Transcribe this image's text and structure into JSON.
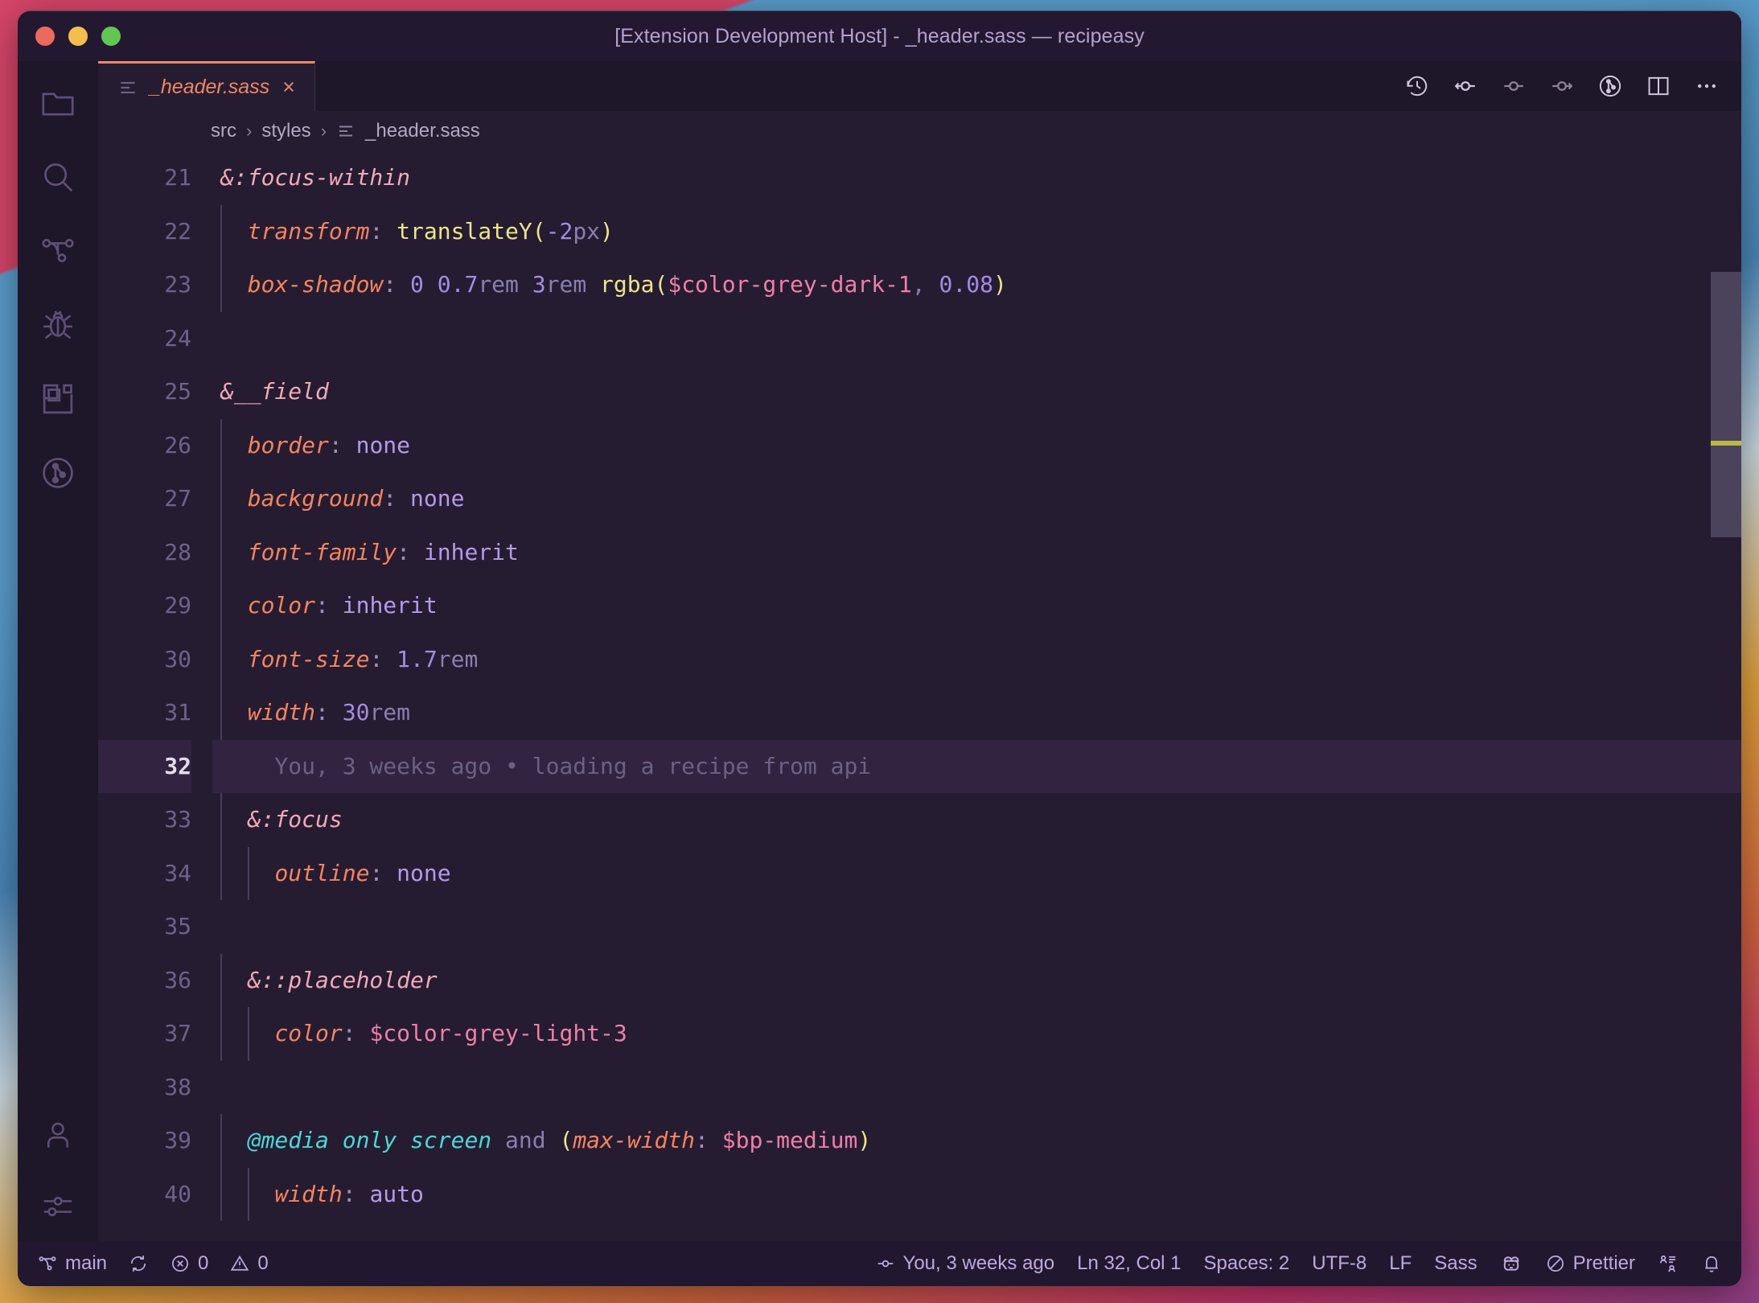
{
  "window": {
    "title": "[Extension Development Host] - _header.sass — recipeasy",
    "traffic_lights": [
      "close",
      "minimize",
      "zoom"
    ]
  },
  "activitybar": {
    "items": [
      {
        "name": "explorer",
        "icon": "folder-icon"
      },
      {
        "name": "search",
        "icon": "search-icon"
      },
      {
        "name": "source-control",
        "icon": "source-control-icon"
      },
      {
        "name": "run-and-debug",
        "icon": "bug-icon"
      },
      {
        "name": "extensions",
        "icon": "extensions-icon"
      },
      {
        "name": "gitlens",
        "icon": "gitlens-icon"
      }
    ],
    "bottom_items": [
      {
        "name": "accounts",
        "icon": "account-icon"
      },
      {
        "name": "manage",
        "icon": "settings-sliders-icon"
      }
    ]
  },
  "tabs": [
    {
      "label": "_header.sass",
      "icon": "sass-file-icon",
      "close": "×",
      "active": true,
      "italic": true
    }
  ],
  "editor_actions": [
    {
      "name": "timeline-history",
      "icon": "history-icon"
    },
    {
      "name": "git-blame-previous",
      "icon": "commit-back-icon"
    },
    {
      "name": "git-commit-current",
      "icon": "commit-icon"
    },
    {
      "name": "git-blame-next",
      "icon": "commit-forward-icon"
    },
    {
      "name": "gitlens-open-file",
      "icon": "gitlens-circle-icon"
    },
    {
      "name": "split-editor-right",
      "icon": "split-editor-icon"
    },
    {
      "name": "more-actions",
      "icon": "ellipsis-icon"
    }
  ],
  "breadcrumbs": {
    "parts": [
      "src",
      "styles",
      "_header.sass"
    ],
    "separator": "›",
    "file_icon": "sass-file-icon"
  },
  "code": {
    "first_line": 21,
    "active_line": 32,
    "lines": [
      {
        "n": 21,
        "tokens": [
          {
            "t": "&:focus-within",
            "c": "t-sel"
          }
        ],
        "indent_guides": 0
      },
      {
        "n": 22,
        "tokens": [
          {
            "t": "  ",
            "c": ""
          },
          {
            "t": "transform",
            "c": "t-prop"
          },
          {
            "t": ": ",
            "c": "t-punc"
          },
          {
            "t": "translateY",
            "c": "t-func"
          },
          {
            "t": "(",
            "c": "t-paren"
          },
          {
            "t": "-2",
            "c": "t-num"
          },
          {
            "t": "px",
            "c": "t-unit"
          },
          {
            "t": ")",
            "c": "t-paren"
          }
        ],
        "indent_guides": 1
      },
      {
        "n": 23,
        "tokens": [
          {
            "t": "  ",
            "c": ""
          },
          {
            "t": "box-shadow",
            "c": "t-prop"
          },
          {
            "t": ": ",
            "c": "t-punc"
          },
          {
            "t": "0",
            "c": "t-num"
          },
          {
            "t": " ",
            "c": ""
          },
          {
            "t": "0.7",
            "c": "t-num"
          },
          {
            "t": "rem",
            "c": "t-unit"
          },
          {
            "t": " ",
            "c": ""
          },
          {
            "t": "3",
            "c": "t-num"
          },
          {
            "t": "rem",
            "c": "t-unit"
          },
          {
            "t": " ",
            "c": ""
          },
          {
            "t": "rgba",
            "c": "t-func"
          },
          {
            "t": "(",
            "c": "t-paren"
          },
          {
            "t": "$color-grey-dark-1",
            "c": "t-var"
          },
          {
            "t": ",",
            "c": "t-unit"
          },
          {
            "t": " ",
            "c": ""
          },
          {
            "t": "0.08",
            "c": "t-num"
          },
          {
            "t": ")",
            "c": "t-paren"
          }
        ],
        "indent_guides": 1
      },
      {
        "n": 24,
        "tokens": [],
        "indent_guides": 0
      },
      {
        "n": 25,
        "tokens": [
          {
            "t": "&__field",
            "c": "t-sel"
          }
        ],
        "indent_guides": 0
      },
      {
        "n": 26,
        "tokens": [
          {
            "t": "  ",
            "c": ""
          },
          {
            "t": "border",
            "c": "t-prop"
          },
          {
            "t": ": ",
            "c": "t-punc"
          },
          {
            "t": "none",
            "c": "t-kw"
          }
        ],
        "indent_guides": 1
      },
      {
        "n": 27,
        "tokens": [
          {
            "t": "  ",
            "c": ""
          },
          {
            "t": "background",
            "c": "t-prop"
          },
          {
            "t": ": ",
            "c": "t-punc"
          },
          {
            "t": "none",
            "c": "t-kw"
          }
        ],
        "indent_guides": 1
      },
      {
        "n": 28,
        "tokens": [
          {
            "t": "  ",
            "c": ""
          },
          {
            "t": "font-family",
            "c": "t-prop"
          },
          {
            "t": ": ",
            "c": "t-punc"
          },
          {
            "t": "inherit",
            "c": "t-kw"
          }
        ],
        "indent_guides": 1
      },
      {
        "n": 29,
        "tokens": [
          {
            "t": "  ",
            "c": ""
          },
          {
            "t": "color",
            "c": "t-prop"
          },
          {
            "t": ": ",
            "c": "t-punc"
          },
          {
            "t": "inherit",
            "c": "t-kw"
          }
        ],
        "indent_guides": 1
      },
      {
        "n": 30,
        "tokens": [
          {
            "t": "  ",
            "c": ""
          },
          {
            "t": "font-size",
            "c": "t-prop"
          },
          {
            "t": ": ",
            "c": "t-punc"
          },
          {
            "t": "1.7",
            "c": "t-num"
          },
          {
            "t": "rem",
            "c": "t-unit"
          }
        ],
        "indent_guides": 1
      },
      {
        "n": 31,
        "tokens": [
          {
            "t": "  ",
            "c": ""
          },
          {
            "t": "width",
            "c": "t-prop"
          },
          {
            "t": ": ",
            "c": "t-punc"
          },
          {
            "t": "30",
            "c": "t-num"
          },
          {
            "t": "rem",
            "c": "t-unit"
          }
        ],
        "indent_guides": 1
      },
      {
        "n": 32,
        "tokens": [
          {
            "t": "    You, 3 weeks ago • loading a recipe from api",
            "c": "blame"
          }
        ],
        "indent_guides": 0,
        "active": true
      },
      {
        "n": 33,
        "tokens": [
          {
            "t": "  ",
            "c": ""
          },
          {
            "t": "&:focus",
            "c": "t-sel"
          }
        ],
        "indent_guides": 1
      },
      {
        "n": 34,
        "tokens": [
          {
            "t": "    ",
            "c": ""
          },
          {
            "t": "outline",
            "c": "t-prop"
          },
          {
            "t": ": ",
            "c": "t-punc"
          },
          {
            "t": "none",
            "c": "t-kw"
          }
        ],
        "indent_guides": 2
      },
      {
        "n": 35,
        "tokens": [],
        "indent_guides": 0
      },
      {
        "n": 36,
        "tokens": [
          {
            "t": "  ",
            "c": ""
          },
          {
            "t": "&::placeholder",
            "c": "t-sel"
          }
        ],
        "indent_guides": 1
      },
      {
        "n": 37,
        "tokens": [
          {
            "t": "    ",
            "c": ""
          },
          {
            "t": "color",
            "c": "t-prop"
          },
          {
            "t": ": ",
            "c": "t-punc"
          },
          {
            "t": "$color-grey-light-3",
            "c": "t-var"
          }
        ],
        "indent_guides": 2
      },
      {
        "n": 38,
        "tokens": [],
        "indent_guides": 0
      },
      {
        "n": 39,
        "tokens": [
          {
            "t": "  ",
            "c": ""
          },
          {
            "t": "@media only screen",
            "c": "t-at"
          },
          {
            "t": " and ",
            "c": "t-and"
          },
          {
            "t": "(",
            "c": "t-paren"
          },
          {
            "t": "max-width",
            "c": "t-prop"
          },
          {
            "t": ": ",
            "c": "t-punc"
          },
          {
            "t": "$bp-medium",
            "c": "t-var"
          },
          {
            "t": ")",
            "c": "t-paren"
          }
        ],
        "indent_guides": 1
      },
      {
        "n": 40,
        "tokens": [
          {
            "t": "    ",
            "c": ""
          },
          {
            "t": "width",
            "c": "t-prop"
          },
          {
            "t": ": ",
            "c": "t-punc"
          },
          {
            "t": "auto",
            "c": "t-kw"
          }
        ],
        "indent_guides": 2
      }
    ],
    "blame_annotation": "You, 3 weeks ago • loading a recipe from api"
  },
  "statusbar": {
    "left": [
      {
        "name": "branch",
        "icon": "source-control-icon",
        "label": "main"
      },
      {
        "name": "sync",
        "icon": "sync-icon",
        "label": ""
      },
      {
        "name": "errors",
        "icon": "error-icon",
        "label": "0"
      },
      {
        "name": "warnings",
        "icon": "warning-icon",
        "label": "0"
      }
    ],
    "right": [
      {
        "name": "gitlens-blame",
        "icon": "commit-icon",
        "label": "You, 3 weeks ago"
      },
      {
        "name": "cursor-position",
        "icon": "",
        "label": "Ln 32, Col 1"
      },
      {
        "name": "indentation",
        "icon": "",
        "label": "Spaces: 2"
      },
      {
        "name": "encoding",
        "icon": "",
        "label": "UTF-8"
      },
      {
        "name": "eol",
        "icon": "",
        "label": "LF"
      },
      {
        "name": "language-mode",
        "icon": "",
        "label": "Sass"
      },
      {
        "name": "feedback-smiley",
        "icon": "smiley-icon",
        "label": ""
      },
      {
        "name": "prettier",
        "icon": "no-entry-icon",
        "label": "Prettier"
      },
      {
        "name": "remote-indicator",
        "icon": "remote-person-icon",
        "label": ""
      },
      {
        "name": "notifications",
        "icon": "bell-icon",
        "label": ""
      }
    ]
  },
  "colors": {
    "editor_bg": "#251c32",
    "activitybar_bg": "#1e1629",
    "titlebar_bg": "#221930",
    "tab_accent": "#f08763",
    "selector": "#f2a9b8",
    "property": "#f4845f",
    "value_keyword": "#b39ae8",
    "number": "#a48ce0",
    "variable": "#ef7fa8",
    "function": "#ebe58b",
    "at_rule": "#4fd6d2",
    "status_text": "#bfa9dc",
    "active_line_bg": "#322341"
  }
}
